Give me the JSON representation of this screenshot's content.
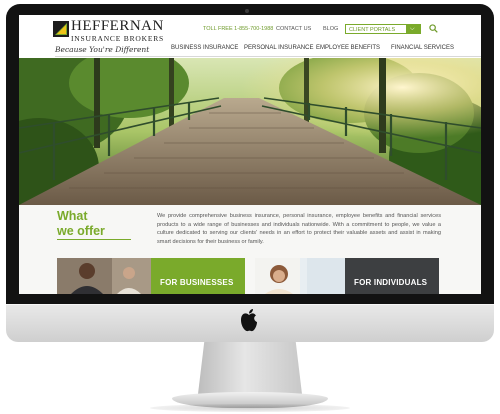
{
  "logo": {
    "name": "HEFFERNAN",
    "sub": "INSURANCE BROKERS",
    "tagline": "Because You're Different"
  },
  "topnav": {
    "toll_free": "TOLL FREE 1-855-700-1988",
    "contact": "CONTACT US",
    "blog": "BLOG",
    "portal_label": "CLIENT PORTALS"
  },
  "mainnav": [
    "BUSINESS INSURANCE",
    "PERSONAL INSURANCE",
    "EMPLOYEE BENEFITS",
    "FINANCIAL SERVICES"
  ],
  "offer": {
    "title_line1": "What",
    "title_line2": "we offer",
    "text": "We provide comprehensive business insurance, personal insurance, employee benefits and financial services products to a wide range of businesses and individuals nationwide. With a commitment to people, we value a culture dedicated to serving our clients' needs in an effort to protect their valuable assets and assist in making smart decisions for their business or family."
  },
  "cards": {
    "businesses": "FOR BUSINESSES",
    "individuals": "FOR INDIVIDUALS"
  },
  "colors": {
    "accent": "#7aaa2b",
    "dark_card": "#3d3f41",
    "bezel": "#121212"
  },
  "icons": {
    "search": "search-icon",
    "dropdown": "chevron-down-icon",
    "apple": "apple-logo-icon"
  }
}
